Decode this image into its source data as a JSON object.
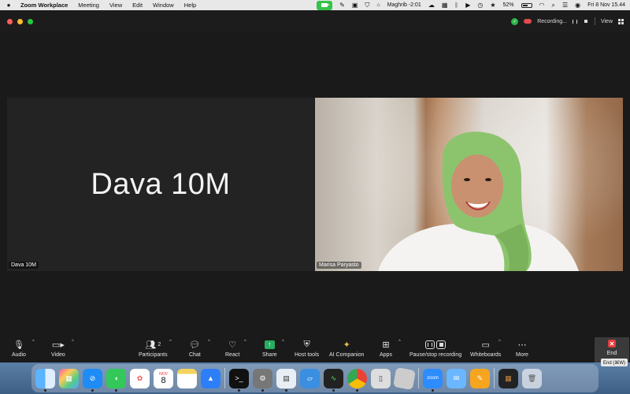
{
  "menubar": {
    "app_name": "Zoom Workplace",
    "menus": [
      "Meeting",
      "View",
      "Edit",
      "Window",
      "Help"
    ],
    "prayer_time": "Maghrib -2:01",
    "battery": "52%",
    "datetime": "Fri 8 Nov  15.44"
  },
  "titlebar": {
    "recording_label": "Recording...",
    "view_label": "View"
  },
  "tiles": {
    "left": {
      "display_name": "Dava 10M",
      "name_tag": "Dava 10M"
    },
    "right": {
      "name_tag": "Marisa Paryasto"
    }
  },
  "toolbar": {
    "audio": "Audio",
    "video": "Video",
    "participants": "Participants",
    "participants_count": "2",
    "chat": "Chat",
    "react": "React",
    "share": "Share",
    "host_tools": "Host tools",
    "ai_companion": "AI Companion",
    "apps": "Apps",
    "recording": "Pause/stop recording",
    "whiteboards": "Whiteboards",
    "more": "More",
    "end": "End",
    "end_tooltip": "End (⌘W)"
  },
  "dock": {
    "calendar_month": "NOV",
    "calendar_day": "8",
    "zoom_label": "zoom",
    "apps": [
      "finder",
      "launchpad",
      "safari",
      "messages",
      "photos",
      "calendar",
      "notes",
      "keynote",
      "terminal",
      "system-settings",
      "preview",
      "remote-desktop",
      "activity-monitor",
      "chrome",
      "ios-simulator",
      "parallels",
      "zoom",
      "mail",
      "pages",
      "photo-booth",
      "trash"
    ]
  },
  "colors": {
    "share_green": "#27ae60",
    "end_red": "#e23b3b",
    "record_red": "#e14b4b"
  }
}
